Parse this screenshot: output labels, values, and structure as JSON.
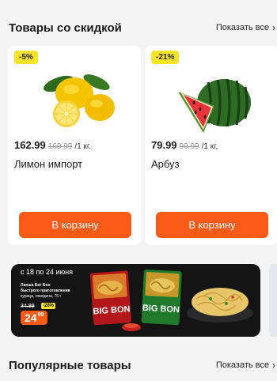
{
  "discount_section": {
    "title": "Товары со скидкой",
    "show_all": "Показать все"
  },
  "products": [
    {
      "badge": "-5%",
      "price": "162.99",
      "old_price": "169.99",
      "unit": "/1 кг.",
      "name": "Лимон импорт",
      "button": "В корзину",
      "image_icon": "lemon-image"
    },
    {
      "badge": "-21%",
      "price": "79.99",
      "old_price": "99.99",
      "unit": "/1 кг.",
      "name": "Арбуз",
      "button": "В корзину",
      "image_icon": "watermelon-image"
    }
  ],
  "promo_banner": {
    "date": "с 18 по 24 июня",
    "desc_line1": "Лапша Биг Бон",
    "desc_line2": "быстрого приготовления",
    "desc_line3": "курица, говядина, 75 г",
    "old_price": "34.99",
    "discount": "-28%",
    "price_main": "24",
    "price_cents": "99",
    "brand_text": "BIG BON"
  },
  "popular_section": {
    "title": "Популярные товары",
    "show_all": "Показать все"
  },
  "colors": {
    "accent": "#fa5a18",
    "badge": "#f7e22a",
    "background": "#f4f4f4"
  }
}
